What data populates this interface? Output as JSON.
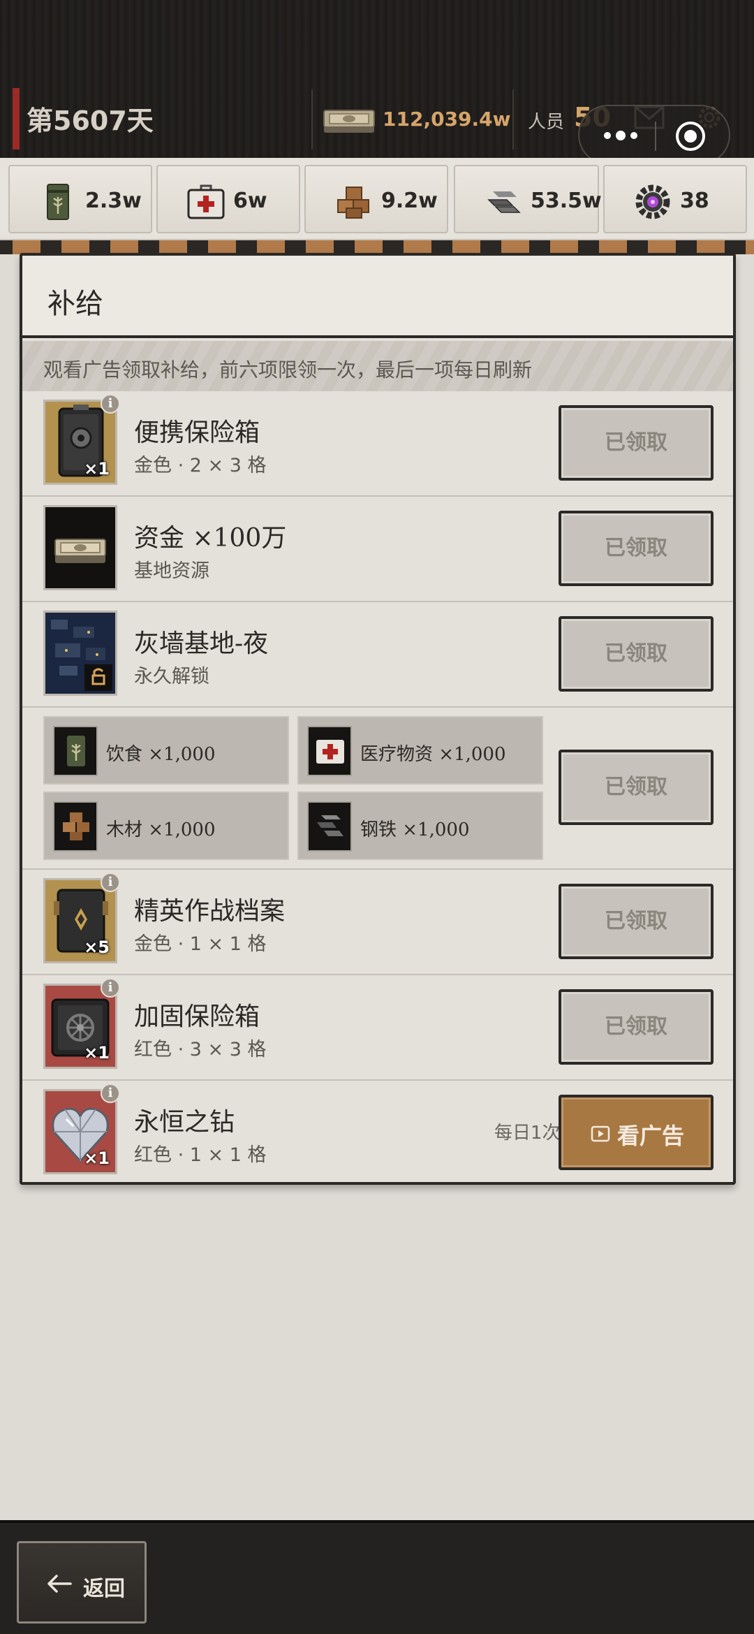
{
  "header": {
    "day": "第5607天",
    "money": "112,039.4w",
    "staff_label": "人员",
    "staff_value": "50"
  },
  "resources": [
    {
      "icon": "food-can-icon",
      "value": "2.3w"
    },
    {
      "icon": "medkit-icon",
      "value": "6w"
    },
    {
      "icon": "wood-icon",
      "value": "9.2w"
    },
    {
      "icon": "steel-icon",
      "value": "53.5w"
    },
    {
      "icon": "gear-gem-icon",
      "value": "38"
    }
  ],
  "panel": {
    "title": "补给",
    "notice": "观看广告领取补给，前六项限领一次，最后一项每日刷新"
  },
  "items": [
    {
      "name": "便携保险箱",
      "sub": "金色 · 2 × 3 格",
      "qty": "×1",
      "button": "已领取"
    },
    {
      "name": "资金 ×100万",
      "sub": "基地资源",
      "button": "已领取"
    },
    {
      "name": "灰墙基地-夜",
      "sub": "永久解锁",
      "button": "已领取"
    },
    {
      "button": "已领取"
    },
    {
      "name": "精英作战档案",
      "sub": "金色 · 1 × 1 格",
      "qty": "×5",
      "button": "已领取"
    },
    {
      "name": "加固保险箱",
      "sub": "红色 · 3 × 3 格",
      "qty": "×1",
      "button": "已领取"
    },
    {
      "name": "永恒之钻",
      "sub": "红色 · 1 × 1 格",
      "qty": "×1",
      "daily": "每日1次",
      "button": "看广告"
    }
  ],
  "bundle": [
    {
      "label": "饮食 ×1,000"
    },
    {
      "label": "医疗物资 ×1,000"
    },
    {
      "label": "木材 ×1,000"
    },
    {
      "label": "钢铁 ×1,000"
    }
  ],
  "info_glyph": "i",
  "back_label": "返回",
  "colors": {
    "accent_gold": "#d6a56a",
    "ad_button": "#a87842",
    "day_accent": "#9b2b26"
  }
}
